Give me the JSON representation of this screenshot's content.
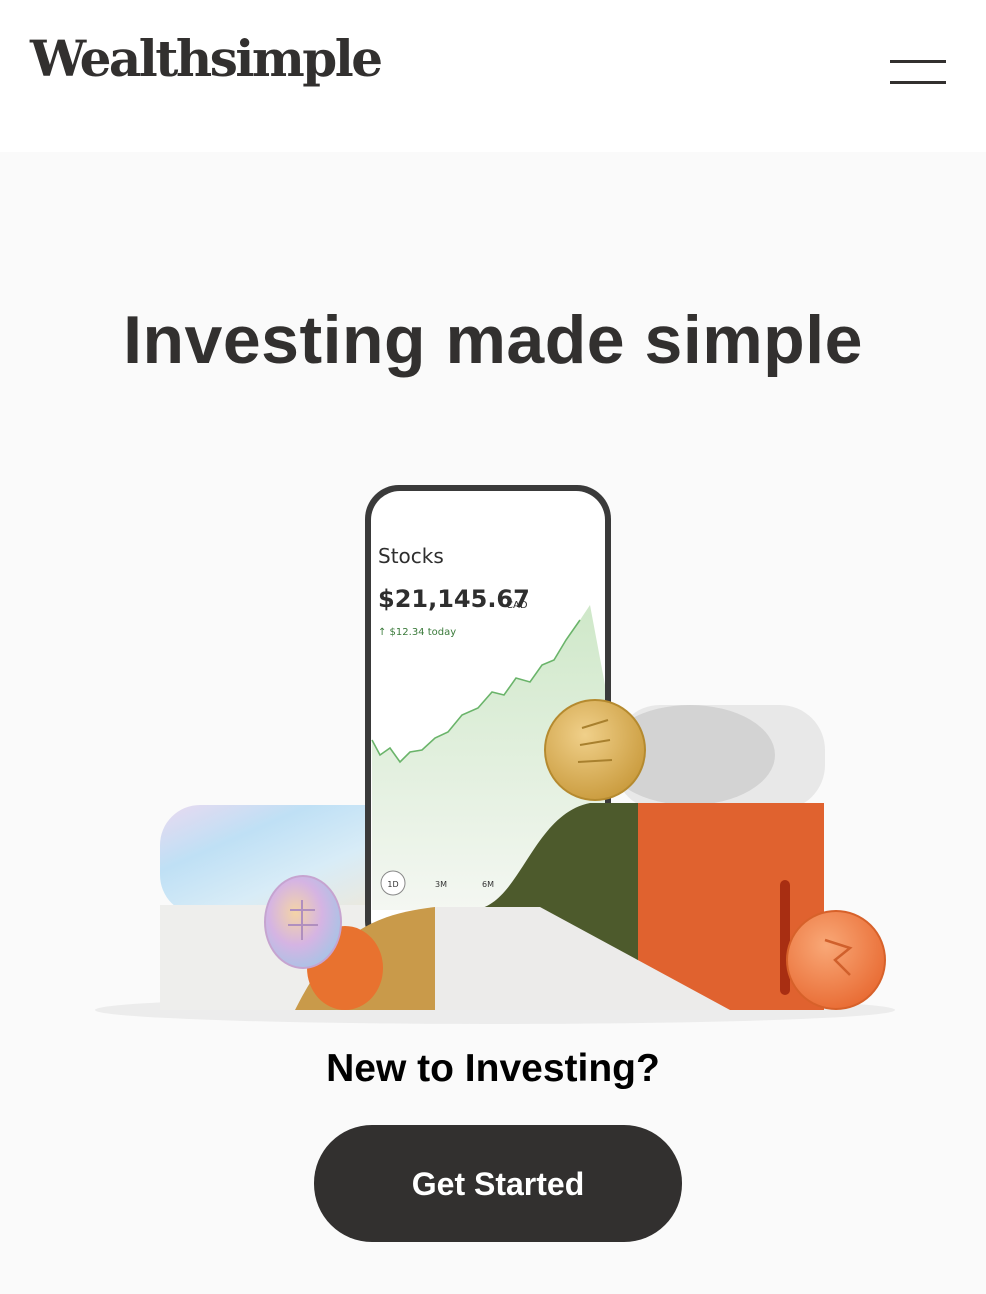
{
  "header": {
    "logo_text": "Wealthsimple",
    "menu_icon": "hamburger-menu-icon"
  },
  "hero": {
    "title": "Investing made simple"
  },
  "illustration": {
    "phone": {
      "title": "Stocks",
      "balance": "$21,145.67",
      "currency": "CAD",
      "change": "↑ $12.34 today",
      "range_buttons": [
        "1D",
        "3M",
        "6M"
      ]
    },
    "colors": {
      "chart_line": "#6ab46a",
      "chart_fill": "#dff0dc",
      "olive_block": "#4d5a2c",
      "orange_block": "#e0622f",
      "gold_coin": "#d8b25a",
      "orange_coin": "#f2834a"
    }
  },
  "cta": {
    "prompt": "New to Investing?",
    "button_label": "Get Started"
  }
}
